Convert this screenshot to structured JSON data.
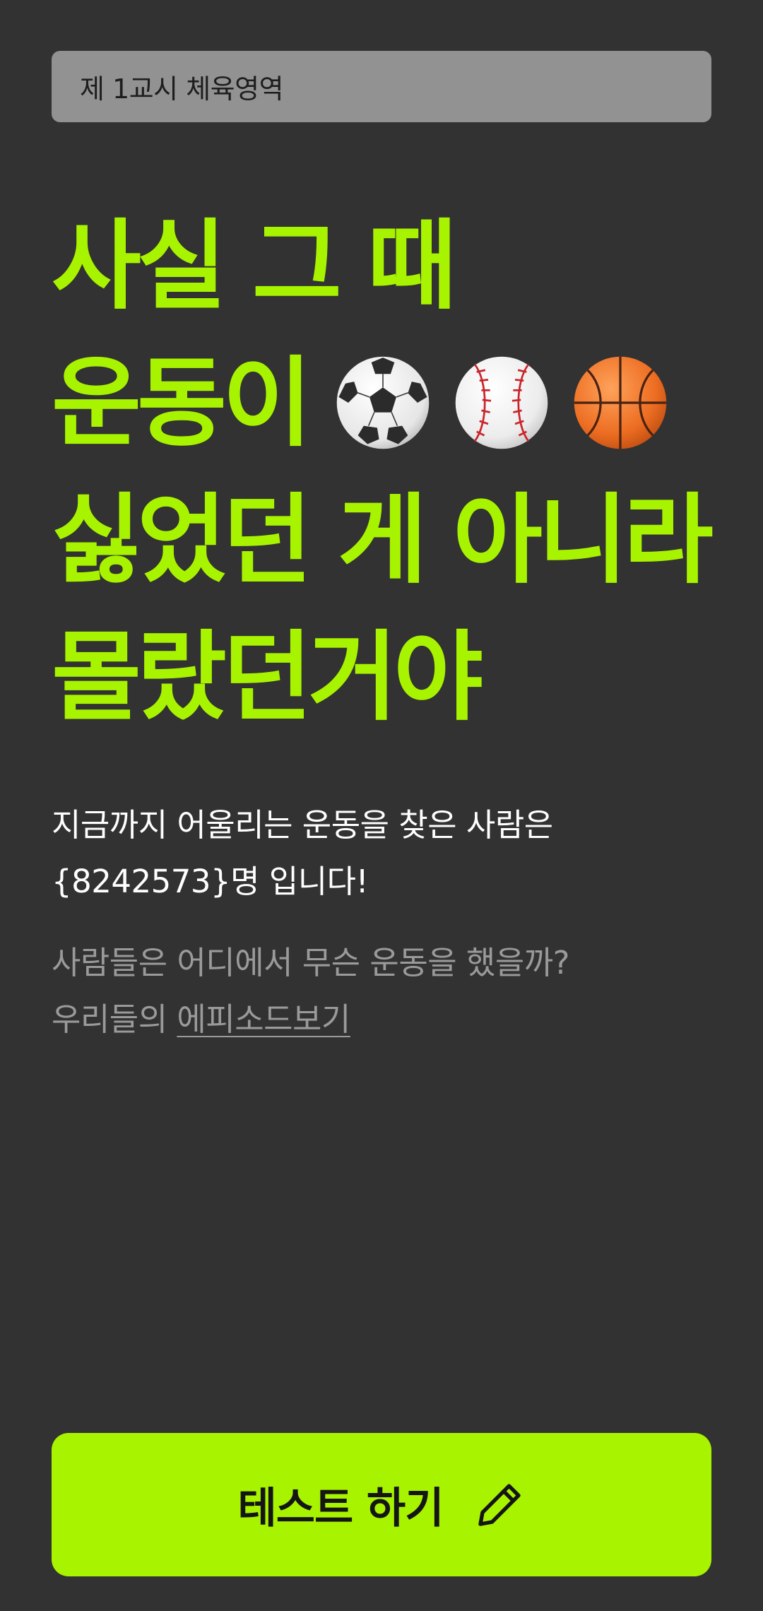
{
  "header": {
    "tag_label": "제 1교시 체육영역"
  },
  "headline": {
    "line1": "사실 그 때",
    "line2": "운동이",
    "line3": "싫었던 게 아니라",
    "line4": "몰랐던거야"
  },
  "icons": {
    "ball1": "soccer-ball-icon",
    "ball2": "baseball-icon",
    "ball3": "basketball-icon",
    "cta": "pencil-icon"
  },
  "stats": {
    "line1": "지금까지 어울리는 운동을 찾은 사람은",
    "line2": "{8242573}명 입니다!"
  },
  "episode": {
    "line1": "사람들은 어디에서 무슨 운동을 했을까?",
    "prefix": "우리들의 ",
    "link_label": "에피소드보기"
  },
  "cta": {
    "label": "테스트 하기"
  },
  "colors": {
    "background": "#323232",
    "accent": "#a8f400",
    "tag_background": "#929292",
    "muted_text": "#9a9a9a"
  }
}
